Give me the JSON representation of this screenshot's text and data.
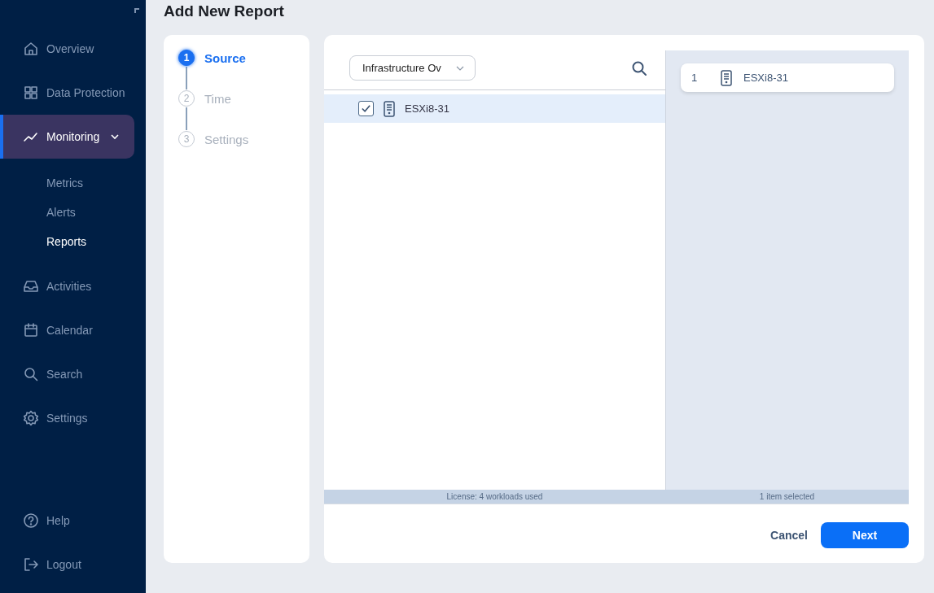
{
  "sidebar": {
    "items": [
      {
        "label": "Overview",
        "selected": false
      },
      {
        "label": "Data Protection",
        "selected": false
      },
      {
        "label": "Monitoring",
        "selected": true,
        "expanded": true,
        "children": [
          {
            "label": "Metrics",
            "selected": false
          },
          {
            "label": "Alerts",
            "selected": false
          },
          {
            "label": "Reports",
            "selected": true
          }
        ]
      },
      {
        "label": "Activities",
        "selected": false
      },
      {
        "label": "Calendar",
        "selected": false
      },
      {
        "label": "Search",
        "selected": false
      },
      {
        "label": "Settings",
        "selected": false
      }
    ],
    "bottom_items": [
      {
        "label": "Help"
      },
      {
        "label": "Logout"
      }
    ]
  },
  "page_title": "Add New Report",
  "steps": [
    {
      "number": "1",
      "label": "Source",
      "selected": true
    },
    {
      "number": "2",
      "label": "Time",
      "selected": false
    },
    {
      "number": "3",
      "label": "Settings",
      "selected": false
    }
  ],
  "source": {
    "dropdown": {
      "value": "Infrastructure Ov"
    },
    "rows": [
      {
        "name": "ESXi8-31",
        "checked": true,
        "selected": true
      }
    ],
    "selected_items": [
      {
        "index": "1",
        "name": "ESXi8-31"
      }
    ],
    "status_left": "License: 4 workloads used",
    "status_right": "1 item selected"
  },
  "buttons": [
    {
      "label": "Cancel",
      "kind": "secondary"
    },
    {
      "label": "Next",
      "kind": "primary"
    }
  ]
}
